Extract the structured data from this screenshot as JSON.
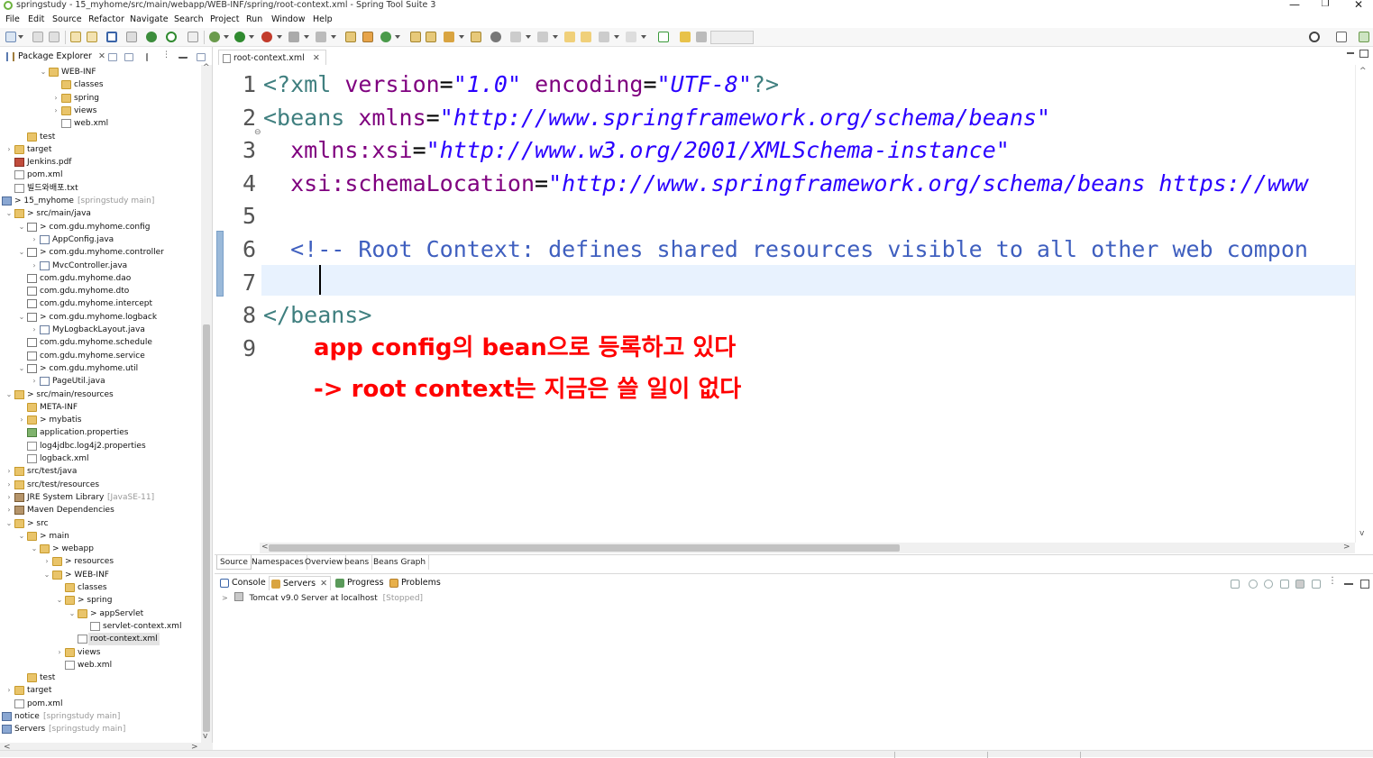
{
  "window": {
    "title": "springstudy - 15_myhome/src/main/webapp/WEB-INF/spring/root-context.xml - Spring Tool Suite 3",
    "minimize": "—",
    "restore": "❐",
    "close": "✕"
  },
  "menu": [
    "File",
    "Edit",
    "Source",
    "Refactor",
    "Navigate",
    "Search",
    "Project",
    "Run",
    "Window",
    "Help"
  ],
  "package_explorer": {
    "tab_label": "Package Explorer",
    "close": "✕",
    "tree": [
      {
        "label": "WEB-INF",
        "icon": "folder",
        "twisty": "v"
      },
      {
        "label": "classes",
        "icon": "folder",
        "twisty": ""
      },
      {
        "label": "spring",
        "icon": "folder",
        "twisty": ">"
      },
      {
        "label": "views",
        "icon": "folder",
        "twisty": ">"
      },
      {
        "label": "web.xml",
        "icon": "xml",
        "twisty": ""
      },
      {
        "label": "test",
        "icon": "folder",
        "twisty": ""
      },
      {
        "label": "target",
        "icon": "folder",
        "twisty": ">"
      },
      {
        "label": "Jenkins.pdf",
        "icon": "pdf",
        "twisty": ""
      },
      {
        "label": "pom.xml",
        "icon": "xml",
        "twisty": ""
      },
      {
        "label": "빌드와배포.txt",
        "icon": "file",
        "twisty": ""
      },
      {
        "label": "> 15_myhome",
        "decoration": "[springstudy main]",
        "icon": "project",
        "twisty": "v"
      },
      {
        "label": "> src/main/java",
        "icon": "pkgfolder",
        "twisty": "v"
      },
      {
        "label": "> com.gdu.myhome.config",
        "icon": "package",
        "twisty": "v"
      },
      {
        "label": "AppConfig.java",
        "icon": "java",
        "twisty": ">"
      },
      {
        "label": "> com.gdu.myhome.controller",
        "icon": "package",
        "twisty": "v"
      },
      {
        "label": "MvcController.java",
        "icon": "java",
        "twisty": ">"
      },
      {
        "label": "com.gdu.myhome.dao",
        "icon": "package",
        "twisty": ""
      },
      {
        "label": "com.gdu.myhome.dto",
        "icon": "package",
        "twisty": ""
      },
      {
        "label": "com.gdu.myhome.intercept",
        "icon": "package",
        "twisty": ""
      },
      {
        "label": "> com.gdu.myhome.logback",
        "icon": "package",
        "twisty": "v"
      },
      {
        "label": "MyLogbackLayout.java",
        "icon": "java",
        "twisty": ">"
      },
      {
        "label": "com.gdu.myhome.schedule",
        "icon": "package",
        "twisty": ""
      },
      {
        "label": "com.gdu.myhome.service",
        "icon": "package",
        "twisty": ""
      },
      {
        "label": "> com.gdu.myhome.util",
        "icon": "package",
        "twisty": "v"
      },
      {
        "label": "PageUtil.java",
        "icon": "java",
        "twisty": ">"
      },
      {
        "label": "> src/main/resources",
        "icon": "pkgfolder",
        "twisty": "v"
      },
      {
        "label": "META-INF",
        "icon": "folder",
        "twisty": ""
      },
      {
        "label": "> mybatis",
        "icon": "folder",
        "twisty": ">"
      },
      {
        "label": "application.properties",
        "icon": "prop",
        "twisty": ""
      },
      {
        "label": "log4jdbc.log4j2.properties",
        "icon": "file",
        "twisty": ""
      },
      {
        "label": "logback.xml",
        "icon": "xml",
        "twisty": ""
      },
      {
        "label": "src/test/java",
        "icon": "pkgfolder",
        "twisty": ">"
      },
      {
        "label": "src/test/resources",
        "icon": "pkgfolder",
        "twisty": ">"
      },
      {
        "label": "JRE System Library",
        "decoration": "[JavaSE-11]",
        "icon": "lib",
        "twisty": ">"
      },
      {
        "label": "Maven Dependencies",
        "icon": "lib",
        "twisty": ">"
      },
      {
        "label": "> src",
        "icon": "folder",
        "twisty": "v"
      },
      {
        "label": "> main",
        "icon": "folder",
        "twisty": "v"
      },
      {
        "label": "> webapp",
        "icon": "folder",
        "twisty": "v"
      },
      {
        "label": "> resources",
        "icon": "folder",
        "twisty": ">"
      },
      {
        "label": "> WEB-INF",
        "icon": "folder",
        "twisty": "v"
      },
      {
        "label": "classes",
        "icon": "folder",
        "twisty": ""
      },
      {
        "label": "> spring",
        "icon": "folder",
        "twisty": "v"
      },
      {
        "label": "> appServlet",
        "icon": "folder",
        "twisty": "v"
      },
      {
        "label": "servlet-context.xml",
        "icon": "xml",
        "twisty": ""
      },
      {
        "label": "root-context.xml",
        "icon": "xml",
        "twisty": "",
        "selected": true
      },
      {
        "label": "views",
        "icon": "folder",
        "twisty": ">"
      },
      {
        "label": "web.xml",
        "icon": "xml",
        "twisty": ""
      },
      {
        "label": "test",
        "icon": "folder",
        "twisty": ""
      },
      {
        "label": "target",
        "icon": "folder",
        "twisty": ">"
      },
      {
        "label": "pom.xml",
        "icon": "xml",
        "twisty": ""
      },
      {
        "label": "notice",
        "decoration": "[springstudy main]",
        "icon": "project",
        "twisty": ">"
      },
      {
        "label": "Servers",
        "decoration": "[springstudy main]",
        "icon": "project",
        "twisty": ">"
      }
    ]
  },
  "editor": {
    "tab_label": "root-context.xml",
    "tab_close": "✕",
    "line_numbers": [
      "1",
      "2",
      "3",
      "4",
      "5",
      "6",
      "7",
      "8",
      "9"
    ],
    "lines": [
      [
        {
          "t": "pi",
          "v": "<?xml "
        },
        {
          "t": "attr",
          "v": "version"
        },
        {
          "t": "eq",
          "v": "="
        },
        {
          "t": "str",
          "v": "\"1.0\""
        },
        {
          "t": "eq",
          "v": " "
        },
        {
          "t": "attr",
          "v": "encoding"
        },
        {
          "t": "eq",
          "v": "="
        },
        {
          "t": "str",
          "v": "\"UTF-8\""
        },
        {
          "t": "pi",
          "v": "?>"
        }
      ],
      [
        {
          "t": "el",
          "v": "<beans "
        },
        {
          "t": "attr",
          "v": "xmlns"
        },
        {
          "t": "eq",
          "v": "="
        },
        {
          "t": "str",
          "v": "\"http://www.springframework.org/schema/beans\""
        }
      ],
      [
        {
          "t": "eq",
          "v": "  "
        },
        {
          "t": "attr",
          "v": "xmlns:xsi"
        },
        {
          "t": "eq",
          "v": "="
        },
        {
          "t": "str",
          "v": "\"http://www.w3.org/2001/XMLSchema-instance\""
        }
      ],
      [
        {
          "t": "eq",
          "v": "  "
        },
        {
          "t": "attr",
          "v": "xsi:schemaLocation"
        },
        {
          "t": "eq",
          "v": "="
        },
        {
          "t": "str",
          "v": "\"http://www.springframework.org/schema/beans https://www"
        }
      ],
      [],
      [
        {
          "t": "eq",
          "v": "  "
        },
        {
          "t": "cm",
          "v": "<!-- Root Context: defines shared resources visible to all other web compon"
        }
      ],
      [],
      [
        {
          "t": "el",
          "v": "</beans>"
        }
      ],
      []
    ],
    "annotation_lines": [
      "app config의 bean으로 등록하고 있다",
      "-> root context는 지금은 쓸 일이 없다"
    ],
    "annotation_color": "#ff0000",
    "bottom_tabs": [
      "Source",
      "Namespaces",
      "Overview",
      "beans",
      "Beans Graph"
    ],
    "active_bottom_tab": "Source"
  },
  "console": {
    "tabs": [
      {
        "label": "Console",
        "icon": "console-icon"
      },
      {
        "label": "Servers",
        "icon": "servers-icon",
        "active": true
      },
      {
        "label": "Progress",
        "icon": "progress-icon"
      },
      {
        "label": "Problems",
        "icon": "problems-icon"
      }
    ],
    "close": "✕",
    "servers": [
      {
        "name": "Tomcat v9.0 Server at localhost",
        "state": "[Stopped]"
      }
    ]
  },
  "colors": {
    "xml_element": "#3f7f7f",
    "xml_attribute": "#7f007f",
    "xml_string": "#2a00ff",
    "xml_comment": "#3f5fbf",
    "current_line": "#e8f2fe"
  }
}
